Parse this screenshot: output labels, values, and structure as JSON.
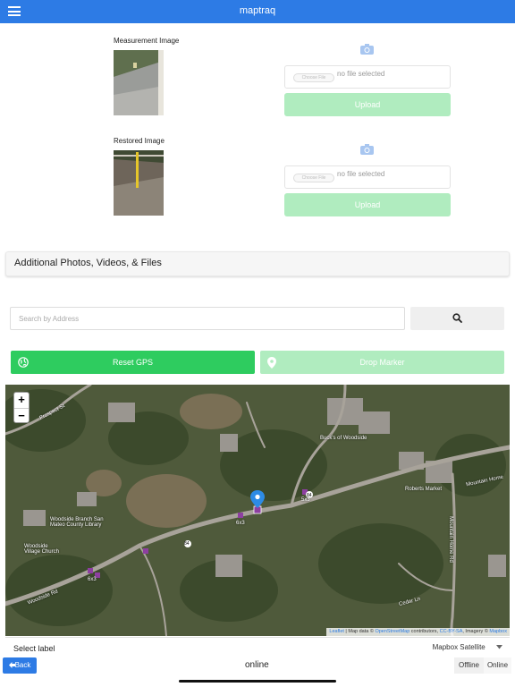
{
  "app": {
    "title": "maptraq"
  },
  "measurement": {
    "label": "Measurement Image",
    "choose_label": "Choose File",
    "no_file": "no file selected",
    "upload_label": "Upload"
  },
  "restored": {
    "label": "Restored Image",
    "choose_label": "Choose File",
    "no_file": "no file selected",
    "upload_label": "Upload"
  },
  "additional": {
    "title": "Additional Photos, Videos, & Files"
  },
  "search": {
    "placeholder": "Search by Address"
  },
  "actions": {
    "reset_gps": "Reset GPS",
    "drop_marker": "Drop Marker"
  },
  "map": {
    "zoom_in": "+",
    "zoom_out": "−",
    "attribution": {
      "leaflet": "Leaflet",
      "text1": " | Map data © ",
      "osm": "OpenStreetMap",
      "text2": " contributors, ",
      "license": "CC-BY-SA",
      "text3": ", Imagery © ",
      "mapbox": "Mapbox"
    },
    "labels": {
      "prospect": "Prospect St",
      "library": "Woodside Branch San\nMateo County Library",
      "church": "Woodside\nVillage Church",
      "woodside_rd": "Woodside Rd",
      "bucks": "Buck's of Woodside",
      "roberts": "Roberts Market",
      "mountain_home": "Mountain Home",
      "mountain_home_rd": "Mountain Home Rd",
      "cedar": "Cedar Ln",
      "route_84a": "84",
      "route_84b": "84",
      "marker_6x3": "6x3",
      "marker_5x3": "5x3",
      "marker_6x3b": "6x3"
    }
  },
  "select": {
    "label": "Select label",
    "layer": "Mapbox Satellite"
  },
  "footer": {
    "back": "Back",
    "status": "online",
    "offline": "Offline",
    "online": "Online"
  },
  "colors": {
    "primary": "#2d7be5",
    "green": "#2ecc5f",
    "green_light": "#b0ecbf"
  }
}
